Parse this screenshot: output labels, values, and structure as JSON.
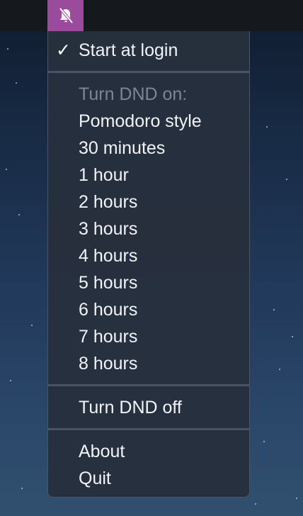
{
  "tray": {
    "icon": "bell-slash-icon"
  },
  "menu": {
    "start_at_login": {
      "label": "Start at login",
      "checked": true,
      "check_glyph": "✓"
    },
    "dnd_header": "Turn DND on:",
    "durations": [
      "Pomodoro style",
      "30 minutes",
      "1 hour",
      "2 hours",
      "3 hours",
      "4 hours",
      "5 hours",
      "6 hours",
      "7 hours",
      "8 hours"
    ],
    "turn_off": "Turn DND off",
    "about": "About",
    "quit": "Quit"
  },
  "colors": {
    "tray_accent": "#9b4b9b",
    "menu_background": "#272f3d",
    "menu_text": "#f2f4f7",
    "header_text": "#7d8697"
  }
}
